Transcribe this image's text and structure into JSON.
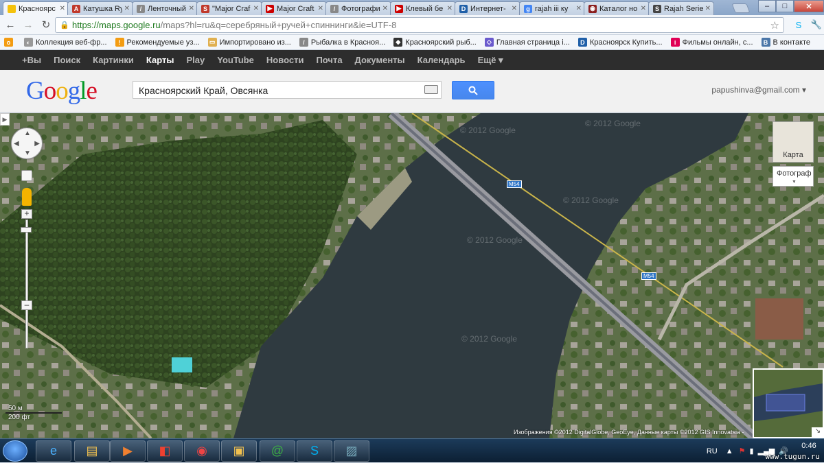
{
  "tabs": [
    {
      "label": "Красноярс",
      "color": "#f4c20d",
      "glyph": "",
      "active": true
    },
    {
      "label": "Катушка Ry",
      "color": "#c0392b",
      "glyph": "A"
    },
    {
      "label": "Ленточный",
      "color": "#888888",
      "glyph": "/"
    },
    {
      "label": "\"Major Craf",
      "color": "#c0392b",
      "glyph": "S"
    },
    {
      "label": "Major Craft",
      "color": "#cc0000",
      "glyph": "▶"
    },
    {
      "label": "Фотографи",
      "color": "#888888",
      "glyph": "/"
    },
    {
      "label": "Клевый бе",
      "color": "#cc0000",
      "glyph": "▶"
    },
    {
      "label": "Интернет-",
      "color": "#1f5fa8",
      "glyph": "D"
    },
    {
      "label": "rajah iii ку",
      "color": "#4285f4",
      "glyph": "g"
    },
    {
      "label": "Каталог но",
      "color": "#8b1e1e",
      "glyph": "◉"
    },
    {
      "label": "Rajah Serie",
      "color": "#444444",
      "glyph": "S"
    }
  ],
  "window_controls": {
    "minimize": "–",
    "maximize": "□",
    "close": "✕"
  },
  "toolbar": {
    "url_scheme": "https://",
    "url_host": "maps.google.ru",
    "url_path": "/maps?hl=ru&q=серебряный+ручей+спиннинги&ie=UTF-8"
  },
  "bookmarks": [
    {
      "label": "",
      "color": "#f39c12",
      "glyph": "o"
    },
    {
      "label": "Коллекция веб-фр...",
      "color": "#999999",
      "glyph": "◐"
    },
    {
      "label": "Рекомендуемые уз...",
      "color": "#f39c12",
      "glyph": "!"
    },
    {
      "label": "Импортировано из...",
      "color": "#e0b050",
      "glyph": "▭"
    },
    {
      "label": "Рыбалка в Красноя...",
      "color": "#888888",
      "glyph": "/"
    },
    {
      "label": "Красноярский рыб...",
      "color": "#333333",
      "glyph": "◆"
    },
    {
      "label": "Главная страница i...",
      "color": "#6a5acd",
      "glyph": "◇"
    },
    {
      "label": "Красноярск Купить...",
      "color": "#1f5fa8",
      "glyph": "D"
    },
    {
      "label": "Фильмы онлайн, с...",
      "color": "#e00055",
      "glyph": "i"
    },
    {
      "label": "В контакте",
      "color": "#4a76a8",
      "glyph": "B"
    }
  ],
  "gbar": [
    "+Вы",
    "Поиск",
    "Картинки",
    "Карты",
    "Play",
    "YouTube",
    "Новости",
    "Почта",
    "Документы",
    "Календарь",
    "Ещё ▾"
  ],
  "gbar_current": "Карты",
  "header": {
    "logo": "Google",
    "search_value": "Красноярский Край, Овсянка",
    "account": "papushinva@gmail.com ▾"
  },
  "map": {
    "type_map": "Карта",
    "type_photo": "Фотограф",
    "scale_m": "50 м",
    "scale_ft": "200 фт",
    "credit": "Изображения ©2012 DigitalGlobe, GeoEye, Данные карты ©2012 GIS Innovatsia -",
    "road_label": "M54",
    "watermark": "© 2012 Google"
  },
  "taskbar": {
    "lang": "RU",
    "time": "0:46"
  },
  "site_watermark": "www.tugun.ru",
  "colors": {
    "accent": "#4d90fe",
    "gbar": "#2d2d2d",
    "river": "#2f3a40"
  }
}
